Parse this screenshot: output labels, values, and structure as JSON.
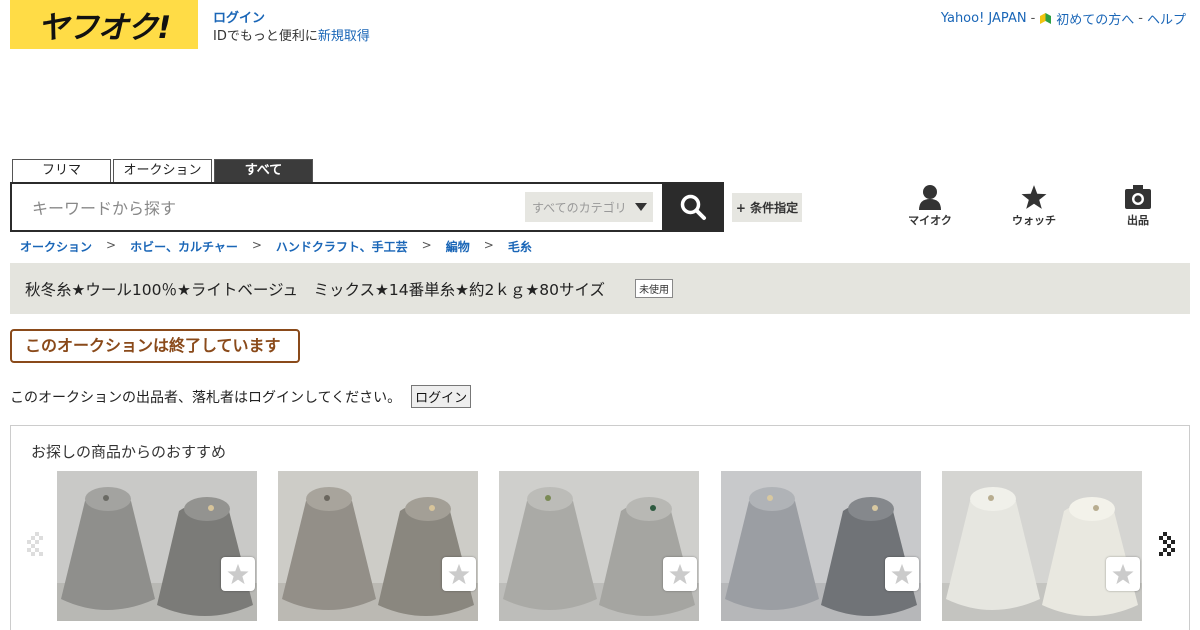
{
  "header": {
    "logo_text": "ヤフオク!",
    "login_label": "ログイン",
    "login_note": "IDでもっと便利に",
    "signup_label": "新規取得",
    "top_links": {
      "yahoo": "Yahoo! JAPAN",
      "sep1": " - ",
      "first_time": "初めての方へ",
      "sep2": " - ",
      "help": "ヘルプ"
    }
  },
  "tabs": [
    {
      "label": "フリマ",
      "active": false
    },
    {
      "label": "オークション",
      "active": false
    },
    {
      "label": "すべて",
      "active": true
    }
  ],
  "search": {
    "placeholder": "キーワードから探す",
    "category": "すべてのカテゴリ",
    "condition_button": "+ 条件指定"
  },
  "nav": {
    "my_auction": "マイオク",
    "watch": "ウォッチ",
    "sell": "出品"
  },
  "breadcrumb": [
    "オークション",
    "ホビー、カルチャー",
    "ハンドクラフト、手工芸",
    "編物",
    "毛糸"
  ],
  "breadcrumb_sep": ">",
  "item": {
    "title": "秋冬糸★ウール100％★ライトベージュ　ミックス★14番単糸★約2ｋｇ★80サイズ",
    "condition": "未使用"
  },
  "status": {
    "ended": "このオークションは終了しています",
    "notice": "このオークションの出品者、落札者はログインしてください。",
    "login_button": "ログイン"
  },
  "recommend": {
    "title": "お探しの商品からのおすすめ",
    "items": [
      {
        "tone": "gray-mix"
      },
      {
        "tone": "beige-gray"
      },
      {
        "tone": "light-gray"
      },
      {
        "tone": "blue-gray"
      },
      {
        "tone": "white"
      }
    ]
  },
  "colors": {
    "brand_yellow": "#ffdc46",
    "link_blue": "#1a66b7",
    "ended_brown": "#8a4a1a",
    "title_bg": "#e4e4de"
  }
}
